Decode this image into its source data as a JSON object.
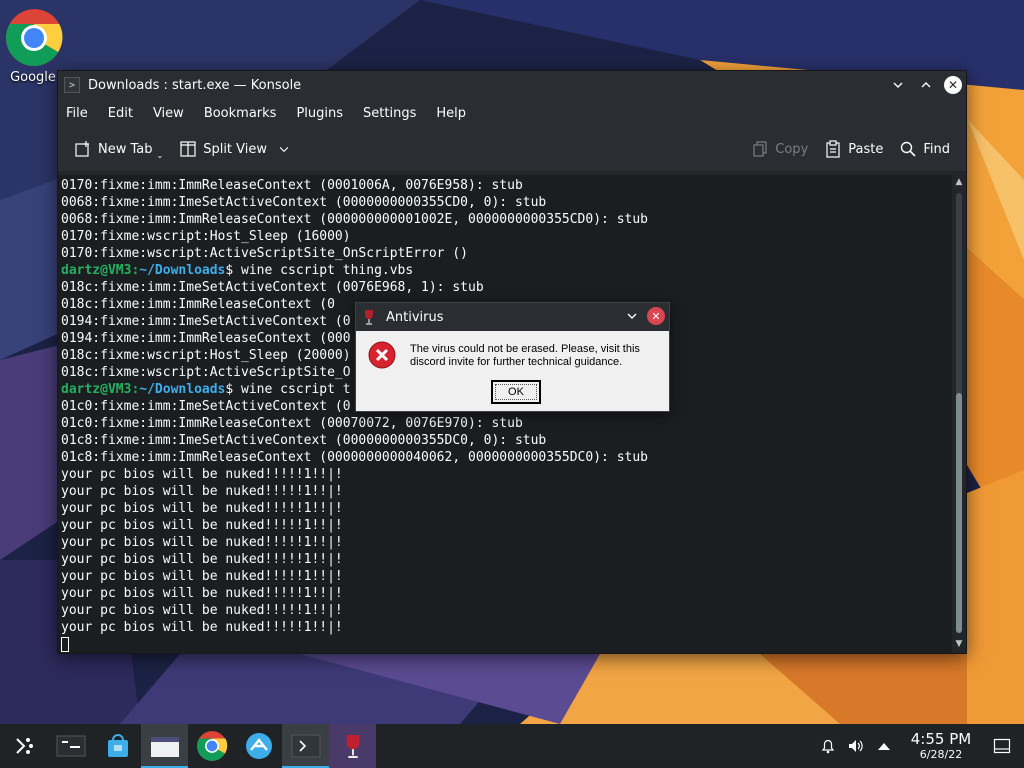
{
  "desktop": {
    "icons": [
      {
        "label": "Google"
      }
    ]
  },
  "konsole": {
    "title": "Downloads : start.exe — Konsole",
    "menu": [
      "File",
      "Edit",
      "View",
      "Bookmarks",
      "Plugins",
      "Settings",
      "Help"
    ],
    "toolbar": {
      "new_tab": "New Tab",
      "split_view": "Split View",
      "copy": "Copy",
      "paste": "Paste",
      "find": "Find"
    },
    "prompt": {
      "user": "dartz@VM3",
      "path": "~/Downloads"
    },
    "lines": [
      "0170:fixme:imm:ImmReleaseContext (0001006A, 0076E958): stub",
      "0068:fixme:imm:ImeSetActiveContext (0000000000355CD0, 0): stub",
      "0068:fixme:imm:ImmReleaseContext (000000000001002E, 0000000000355CD0): stub",
      "0170:fixme:wscript:Host_Sleep (16000)",
      "0170:fixme:wscript:ActiveScriptSite_OnScriptError ()",
      {
        "prompt": true,
        "cmd": "$ wine cscript thing.vbs"
      },
      "018c:fixme:imm:ImeSetActiveContext (0076E968, 1): stub",
      "018c:fixme:imm:ImmReleaseContext (0",
      "0194:fixme:imm:ImeSetActiveContext (0",
      "0194:fixme:imm:ImmReleaseContext (000",
      "018c:fixme:wscript:Host_Sleep (20000)",
      "018c:fixme:wscript:ActiveScriptSite_O",
      {
        "prompt": true,
        "cmd": "$ wine cscript t"
      },
      "01c0:fixme:imm:ImeSetActiveContext (0",
      "01c0:fixme:imm:ImmReleaseContext (00070072, 0076E970): stub",
      "01c8:fixme:imm:ImeSetActiveContext (0000000000355DC0, 0): stub",
      "01c8:fixme:imm:ImmReleaseContext (0000000000040062, 0000000000355DC0): stub",
      "your pc bios will be nuked!!!!!1!!|!",
      "your pc bios will be nuked!!!!!1!!|!",
      "your pc bios will be nuked!!!!!1!!|!",
      "your pc bios will be nuked!!!!!1!!|!",
      "your pc bios will be nuked!!!!!1!!|!",
      "your pc bios will be nuked!!!!!1!!|!",
      "your pc bios will be nuked!!!!!1!!|!",
      "your pc bios will be nuked!!!!!1!!|!",
      "your pc bios will be nuked!!!!!1!!|!",
      "your pc bios will be nuked!!!!!1!!|!"
    ]
  },
  "dialog": {
    "title": "Antivirus",
    "message": "The virus could not be erased. Please, visit this discord invite for further technical guidance.",
    "ok_label": "OK"
  },
  "taskbar": {
    "items": [
      "app-launcher-icon",
      "pager-icon",
      "discover-store-icon",
      "file-manager-icon",
      "chrome-icon",
      "network-app-icon",
      "konsole-icon",
      "wine-icon"
    ],
    "time": "4:55 PM",
    "date": "6/28/22"
  },
  "colors": {
    "prompt_user": "#27ae60",
    "prompt_path": "#3daee9",
    "error_red": "#d6232f",
    "accent": "#3daee9"
  }
}
